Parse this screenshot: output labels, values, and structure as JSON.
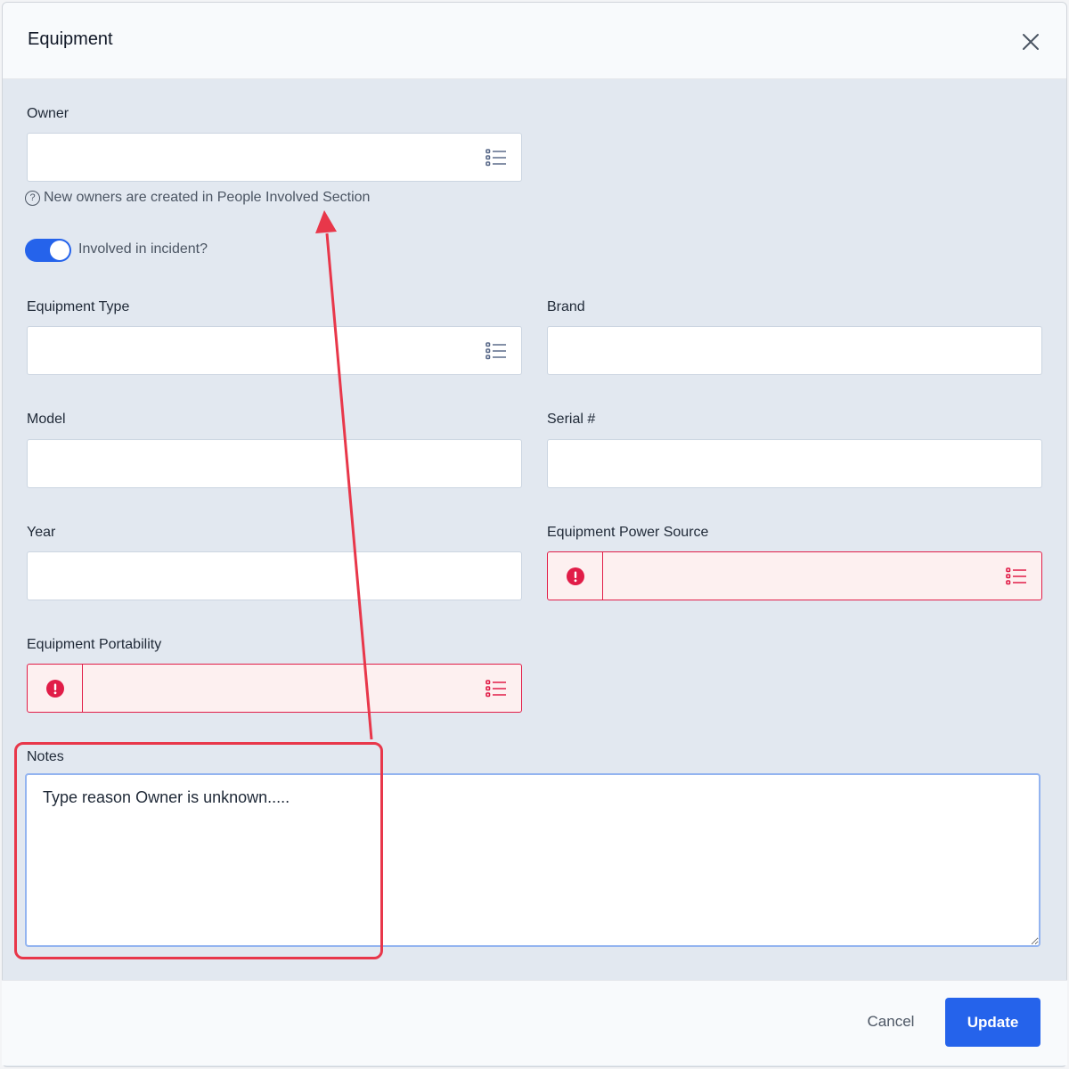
{
  "modal": {
    "title": "Equipment"
  },
  "owner": {
    "label": "Owner",
    "value": "",
    "hint": "New owners are created in People Involved Section"
  },
  "incident": {
    "label": "Involved in incident?",
    "checked": true
  },
  "equipment_type": {
    "label": "Equipment Type",
    "value": ""
  },
  "brand": {
    "label": "Brand",
    "value": ""
  },
  "model": {
    "label": "Model",
    "value": ""
  },
  "serial": {
    "label": "Serial #",
    "value": ""
  },
  "year": {
    "label": "Year",
    "value": ""
  },
  "power_source": {
    "label": "Equipment Power Source",
    "value": ""
  },
  "portability": {
    "label": "Equipment Portability",
    "value": ""
  },
  "notes": {
    "label": "Notes",
    "value": "Type reason Owner is unknown....."
  },
  "footer": {
    "cancel_label": "Cancel",
    "update_label": "Update"
  },
  "colors": {
    "accent": "#2563eb",
    "error": "#e11d48",
    "annotation": "#e8374a"
  },
  "icons": {
    "close": "close-icon",
    "list": "list-icon",
    "error": "error-icon",
    "help": "help-icon"
  }
}
